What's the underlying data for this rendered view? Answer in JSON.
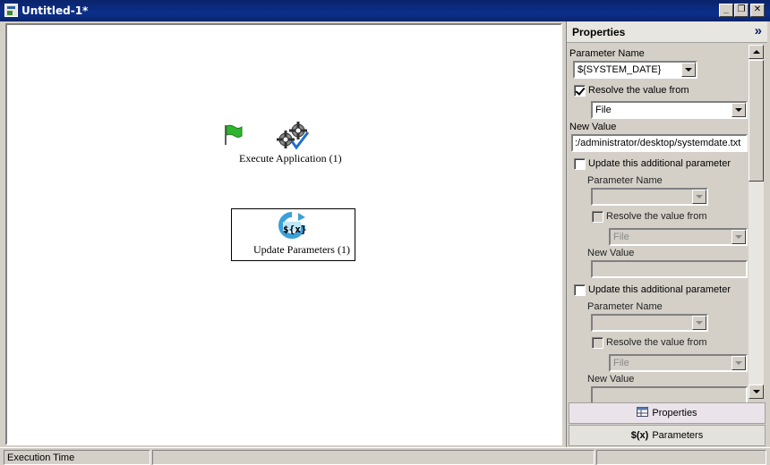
{
  "window": {
    "title": "Untitled-1*",
    "buttons": {
      "minimize": "_",
      "restore": "❐",
      "close": "✕"
    }
  },
  "canvas": {
    "nodes": [
      {
        "label": "Execute Application (1)",
        "icon": "gears-check-icon"
      },
      {
        "label": "Update Parameters (1)",
        "icon": "parameter-refresh-icon",
        "icon_text": "${x}",
        "selected": true
      }
    ],
    "start_icon": "green-flag-icon"
  },
  "panel": {
    "title": "Properties",
    "collapse_glyph": "»",
    "parameter_name_label": "Parameter Name",
    "parameter_name_value": "${SYSTEM_DATE}",
    "resolve_label": "Resolve the value from",
    "resolve_checked": true,
    "resolve_source": "File",
    "new_value_label": "New Value",
    "new_value": ":/administrator/desktop/systemdate.txt",
    "additional": [
      {
        "label": "Update this additional parameter",
        "parameter_name_label": "Parameter Name",
        "parameter_name_value": "",
        "resolve_label": "Resolve the value from",
        "resolve_source": "File",
        "new_value_label": "New Value",
        "new_value": ""
      },
      {
        "label": "Update this additional parameter",
        "parameter_name_label": "Parameter Name",
        "parameter_name_value": "",
        "resolve_label": "Resolve the value from",
        "resolve_source": "File",
        "new_value_label": "New Value",
        "new_value": ""
      }
    ],
    "tabs": [
      {
        "label": "Properties",
        "icon": "properties-grid-icon"
      },
      {
        "label": "Parameters",
        "icon": "parameters-icon",
        "icon_text": "$(x)"
      }
    ]
  },
  "statusbar": {
    "label": "Execution Time"
  },
  "colors": {
    "titlebar": "#0a246a",
    "flag_green": "#2fb52f",
    "param_icon_blue": "#3aa0d8"
  }
}
